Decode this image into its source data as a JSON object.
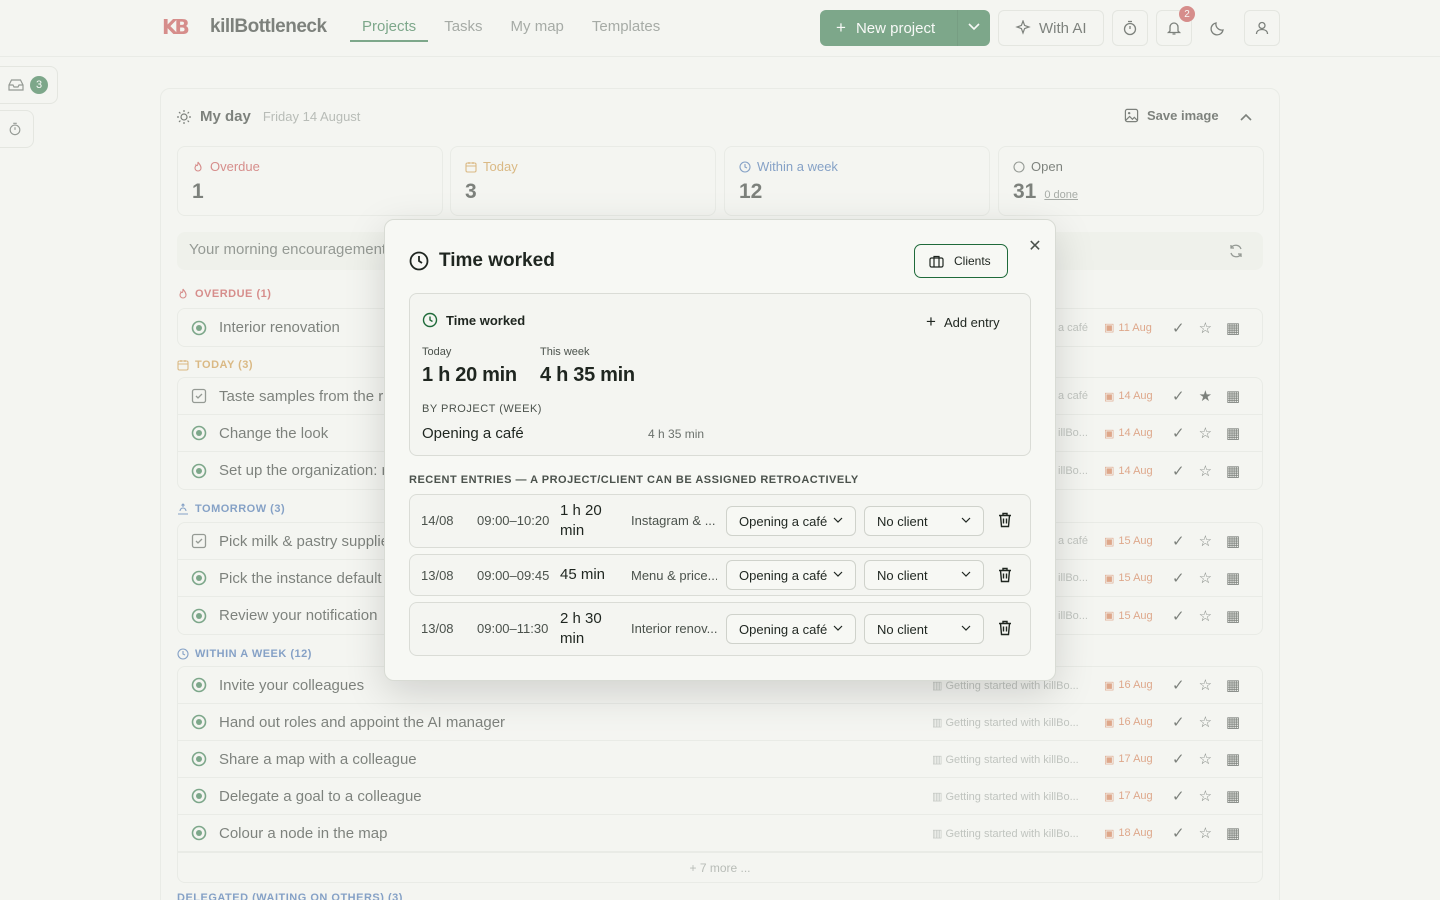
{
  "app": {
    "name": "killBottleneck",
    "logo_mark": "KB",
    "nav": [
      {
        "label": "Projects",
        "active": true
      },
      {
        "label": "Tasks",
        "active": false
      },
      {
        "label": "My map",
        "active": false
      },
      {
        "label": "Templates",
        "active": false
      }
    ],
    "new_project_label": "New project",
    "with_ai_label": "With AI",
    "notifications_count": "2",
    "inbox_count": "3"
  },
  "myday": {
    "title": "My day",
    "date": "Friday 14 August",
    "save_image_label": "Save image",
    "stats": [
      {
        "label": "Overdue",
        "value": "1",
        "color": "#c23b3b"
      },
      {
        "label": "Today",
        "value": "3",
        "color": "#c98a2e"
      },
      {
        "label": "Within a week",
        "value": "12",
        "color": "#2f5fa6"
      },
      {
        "label": "Open",
        "value": "31",
        "sub": "0 done",
        "color": "#4b524c"
      }
    ],
    "encouragement": "Your morning encouragement"
  },
  "sections": {
    "overdue": "OVERDUE (1)",
    "today": "TODAY (3)",
    "tomorrow": "TOMORROW (3)",
    "week": "WITHIN A WEEK (12)",
    "delegated": "DELEGATED (WAITING ON OTHERS) (3)"
  },
  "tasks": {
    "overdue": [
      {
        "title": "Interior renovation",
        "meta": "a café",
        "date": "11 Aug",
        "starred": false
      }
    ],
    "today": [
      {
        "title": "Taste samples from the r",
        "meta": "a café",
        "date": "14 Aug",
        "starred": true
      },
      {
        "title": "Change the look",
        "meta": "illBo...",
        "date": "14 Aug",
        "starred": false
      },
      {
        "title": "Set up the organization: r",
        "meta": "illBo...",
        "date": "14 Aug",
        "starred": false
      }
    ],
    "tomorrow": [
      {
        "title": "Pick milk & pastry supplie",
        "meta": "a café",
        "date": "15 Aug",
        "starred": false
      },
      {
        "title": "Pick the instance default",
        "meta": "illBo...",
        "date": "15 Aug",
        "starred": false
      },
      {
        "title": "Review your notification",
        "meta": "illBo...",
        "date": "15 Aug",
        "starred": false
      }
    ],
    "week": [
      {
        "title": "Invite your colleagues",
        "meta": "Getting started with killBo...",
        "date": "16 Aug"
      },
      {
        "title": "Hand out roles and appoint the AI manager",
        "meta": "Getting started with killBo...",
        "date": "16 Aug"
      },
      {
        "title": "Share a map with a colleague",
        "meta": "Getting started with killBo...",
        "date": "17 Aug"
      },
      {
        "title": "Delegate a goal to a colleague",
        "meta": "Getting started with killBo...",
        "date": "17 Aug"
      },
      {
        "title": "Colour a node in the map",
        "meta": "Getting started with killBo...",
        "date": "18 Aug"
      }
    ],
    "week_more": "+ 7 more ..."
  },
  "modal": {
    "title": "Time worked",
    "clients_label": "Clients",
    "card_title": "Time worked",
    "add_entry_label": "Add entry",
    "today_label": "Today",
    "today_value": "1 h 20 min",
    "week_label": "This week",
    "week_value": "4 h 35 min",
    "by_project_label": "BY PROJECT (WEEK)",
    "project_name": "Opening a café",
    "project_time": "4 h 35 min",
    "recent_label": "RECENT ENTRIES — A PROJECT/CLIENT CAN BE ASSIGNED RETROACTIVELY",
    "entries": [
      {
        "date": "14/08",
        "time": "09:00–10:20",
        "dur1": "1 h 20",
        "dur2": "min",
        "name": "Instagram & ...",
        "project": "Opening a café",
        "client": "No client"
      },
      {
        "date": "13/08",
        "time": "09:00–09:45",
        "dur1": "45 min",
        "dur2": "",
        "name": "Menu & price...",
        "project": "Opening a café",
        "client": "No client"
      },
      {
        "date": "13/08",
        "time": "09:00–11:30",
        "dur1": "2 h 30",
        "dur2": "min",
        "name": "Interior renov...",
        "project": "Opening a café",
        "client": "No client"
      }
    ]
  }
}
